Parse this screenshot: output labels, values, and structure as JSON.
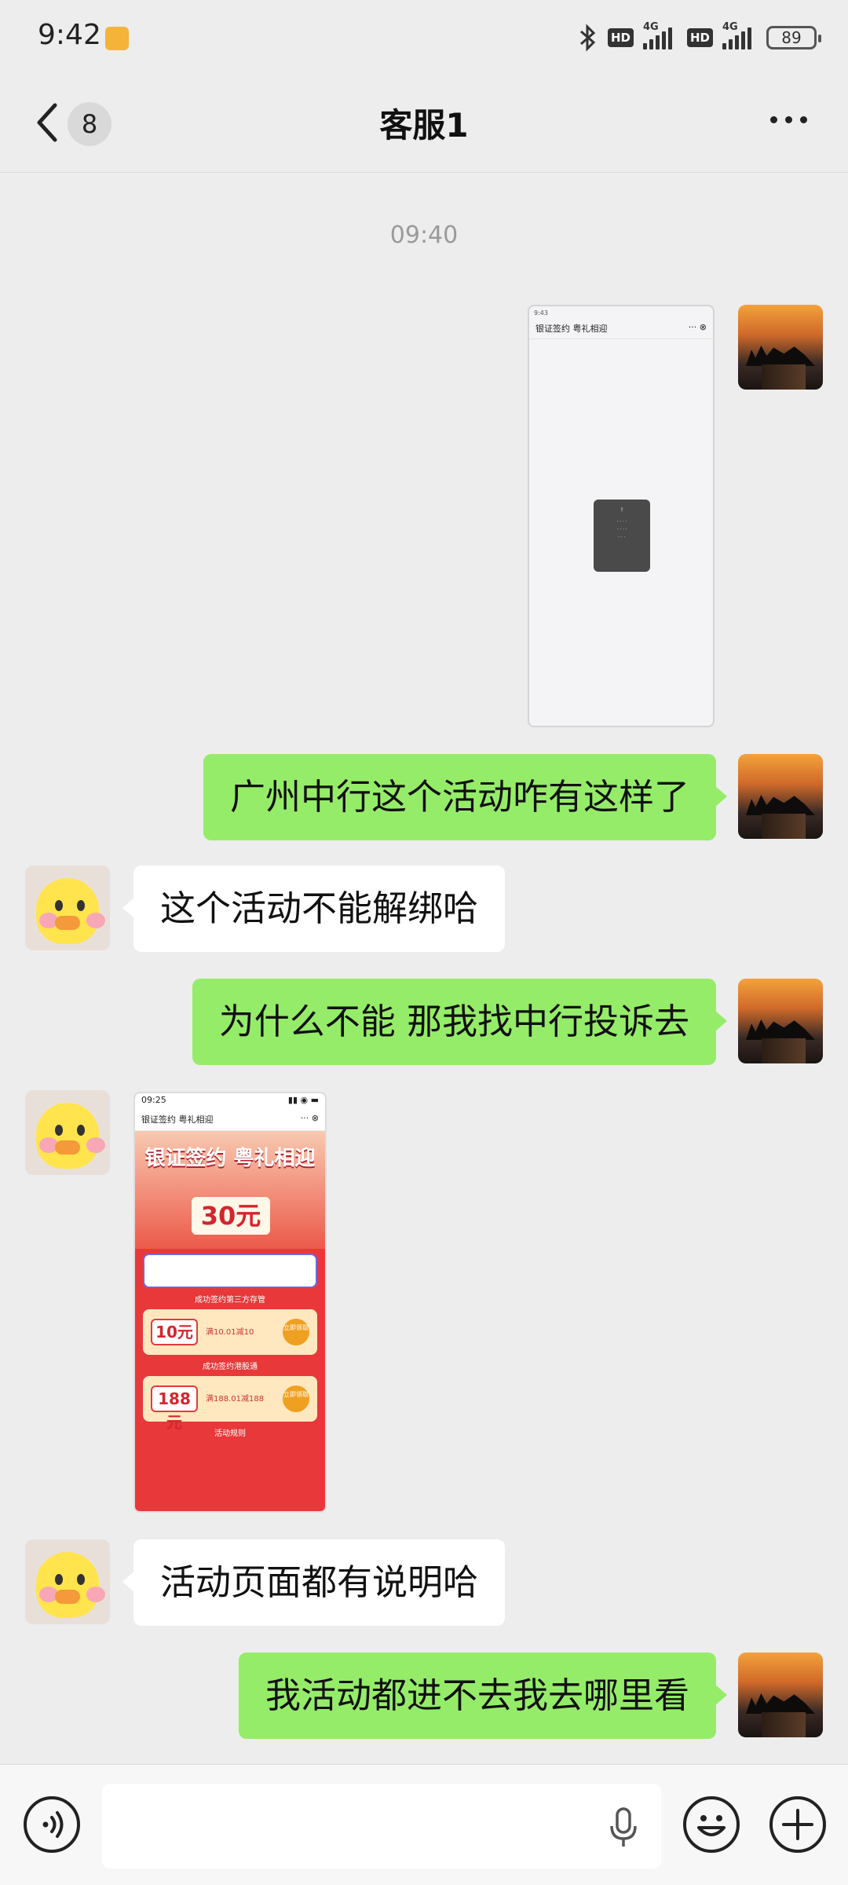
{
  "status_bar": {
    "time": "9:42",
    "hd1": "HD",
    "net1": "4G",
    "hd2": "HD",
    "net2": "4G",
    "battery": "89"
  },
  "nav": {
    "unread_count": "8",
    "title": "客服1"
  },
  "chat": {
    "timestamp": "09:40",
    "image1": {
      "status_time": "9:43",
      "header_title": "银证签约 粤礼相迎",
      "toast_text": "!"
    },
    "messages": [
      {
        "sender": "me",
        "text": "广州中行这个活动咋有这样了"
      },
      {
        "sender": "them",
        "text": "这个活动不能解绑哈"
      },
      {
        "sender": "me",
        "text": "为什么不能 那我找中行投诉去"
      },
      {
        "sender": "them",
        "text": "活动页面都有说明哈"
      },
      {
        "sender": "me",
        "text": "我活动都进不去我去哪里看"
      }
    ],
    "image2": {
      "status_time": "09:25",
      "header_title": "银证签约 粤礼相迎",
      "banner_title": "银证签约 粤礼相迎",
      "banner_amount": "30元",
      "section1": "成功签约第三方存管",
      "card1_amount": "10元",
      "card1_desc": "满10.01减10",
      "card1_btn": "立即领取",
      "section2": "成功签约港股通",
      "card2_amount": "188元",
      "card2_desc": "满188.01减188",
      "card2_btn": "立即领取",
      "section3": "活动规则"
    }
  },
  "input_bar": {
    "text_value": ""
  },
  "icons": {
    "back": "chevron-left-icon",
    "more": "more-dots-icon",
    "voice": "voice-icon",
    "mic": "microphone-icon",
    "emoji": "emoji-icon",
    "plus": "plus-icon"
  },
  "colors": {
    "background": "#ededed",
    "my_bubble": "#95ec69",
    "their_bubble": "#ffffff"
  }
}
